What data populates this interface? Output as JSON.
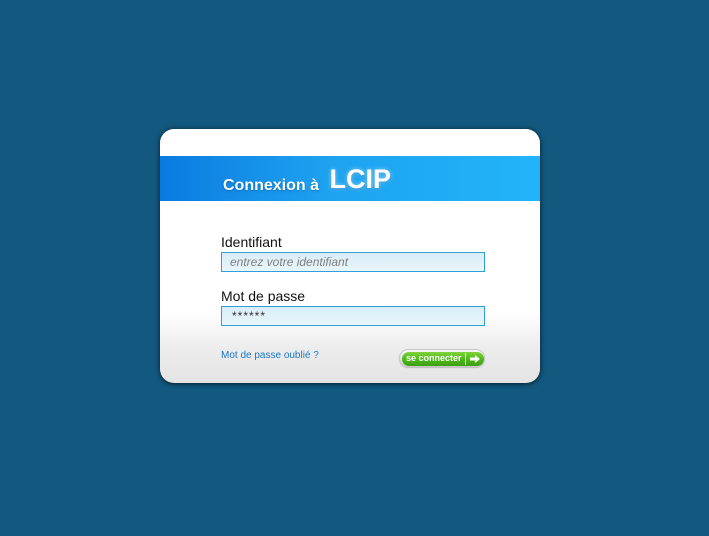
{
  "header": {
    "title_prefix": "Connexion à",
    "title_brand": "LCIP"
  },
  "form": {
    "login_label": "Identifiant",
    "login_placeholder": "entrez votre identifiant",
    "login_value": "",
    "password_label": "Mot de passe",
    "password_value": "******",
    "forgot_password_link": "Mot de passe oublié ?",
    "submit_label": "se connecter",
    "submit_icon": "arrow-right-icon"
  },
  "colors": {
    "page_background": "#13597f",
    "banner_start": "#0a7be0",
    "banner_end": "#22b4f8",
    "submit_button": "#4db61b",
    "link": "#1a78c8",
    "input_border": "#2f9fd6"
  }
}
